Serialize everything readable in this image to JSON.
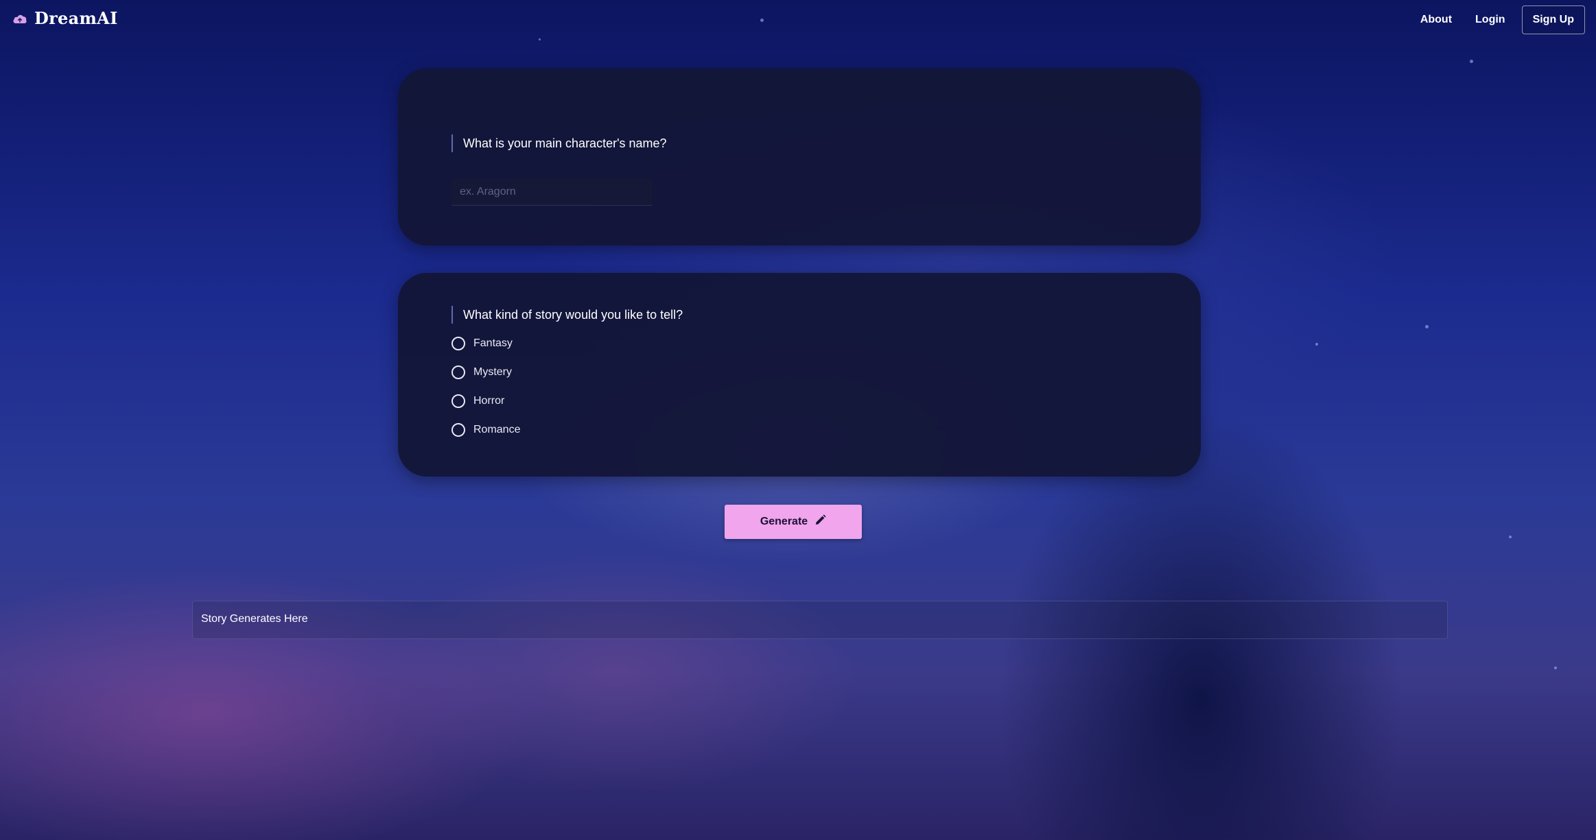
{
  "header": {
    "brand": "DreamAI",
    "nav": {
      "about": "About",
      "login": "Login",
      "signup": "Sign Up"
    }
  },
  "form": {
    "name_question": {
      "label": "What is your main character's name?",
      "placeholder": "ex. Aragorn",
      "value": ""
    },
    "genre_question": {
      "label": "What kind of story would you like to tell?",
      "options": [
        "Fantasy",
        "Mystery",
        "Horror",
        "Romance"
      ],
      "selected": null
    },
    "generate_button": {
      "label": "Generate",
      "icon": "pencil-icon"
    }
  },
  "output": {
    "placeholder_text": "Story Generates Here"
  },
  "colors": {
    "accent_button": "#f0a5ec",
    "card_bg": "#13163a",
    "logo_icon": "#d9a0e8"
  },
  "icons": {
    "logo": "cloud-icon",
    "generate": "pencil-icon"
  }
}
